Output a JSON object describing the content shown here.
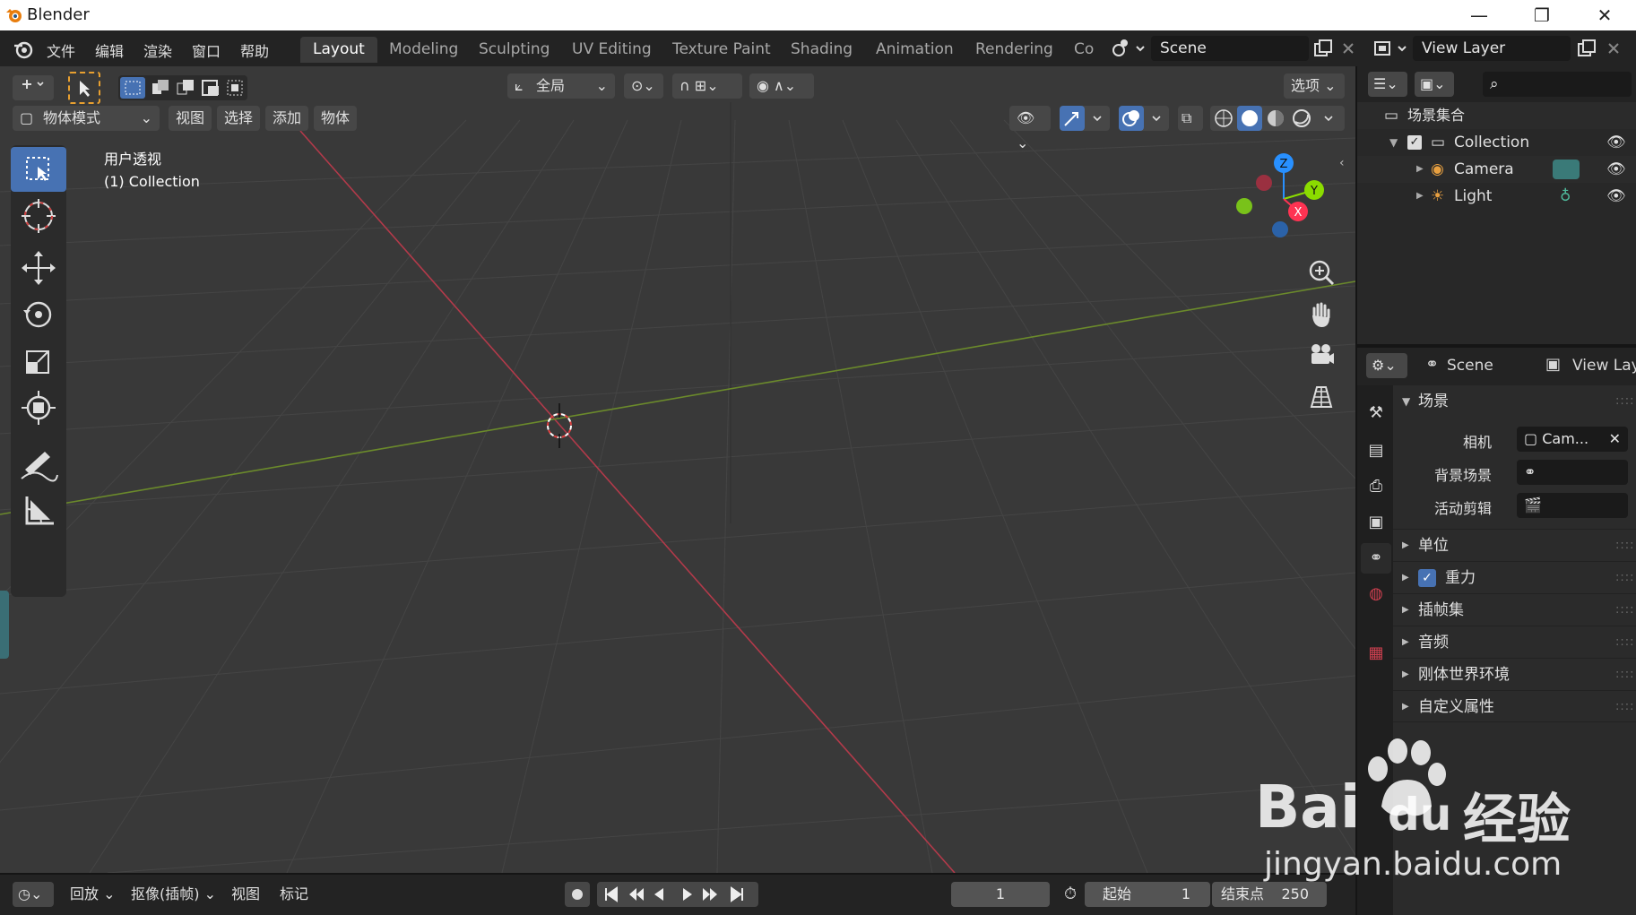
{
  "window": {
    "title": "Blender",
    "minimize": "—",
    "maximize": "❐",
    "close": "✕"
  },
  "menus": [
    "文件",
    "编辑",
    "渲染",
    "窗口",
    "帮助"
  ],
  "workspaces": [
    "Layout",
    "Modeling",
    "Sculpting",
    "UV Editing",
    "Texture Paint",
    "Shading",
    "Animation",
    "Rendering",
    "Co"
  ],
  "scene_field": "Scene",
  "view_layer_field": "View Layer",
  "viewport": {
    "transform_orientation": "全局",
    "options_label": "选项",
    "mode": "物体模式",
    "header_menus": [
      "视图",
      "选择",
      "添加",
      "物体"
    ],
    "overlay_line1": "用户透视",
    "overlay_line2": "(1) Collection",
    "gizmo": {
      "x": "X",
      "y": "Y",
      "z": "Z"
    }
  },
  "outliner": {
    "root": "场景集合",
    "collection": "Collection",
    "items": [
      "Camera",
      "Light"
    ]
  },
  "properties": {
    "scene_tab": "Scene",
    "view_layer_tab": "View Lay",
    "panel_scene": "场景",
    "camera_label": "相机",
    "camera_value": "Cam...",
    "background_label": "背景场景",
    "active_clip_label": "活动剪辑",
    "subpanels": [
      "单位",
      "重力",
      "插帧集",
      "音频",
      "刚体世界环境",
      "自定义属性"
    ]
  },
  "timeline": {
    "playback": "回放",
    "keying": "抠像(插帧)",
    "view": "视图",
    "marker": "标记",
    "current_frame": "1",
    "start_label": "起始",
    "start_value": "1",
    "end_label": "结束点",
    "end_value": "250"
  },
  "watermark": {
    "brand": "Bai",
    "brand2": "du",
    "cn": "经验",
    "url": "jingyan.baidu.com"
  },
  "colors": {
    "accent": "#4772b3",
    "x_axis": "#ff3352",
    "y_axis": "#8bdc00",
    "z_axis": "#2890ff"
  }
}
